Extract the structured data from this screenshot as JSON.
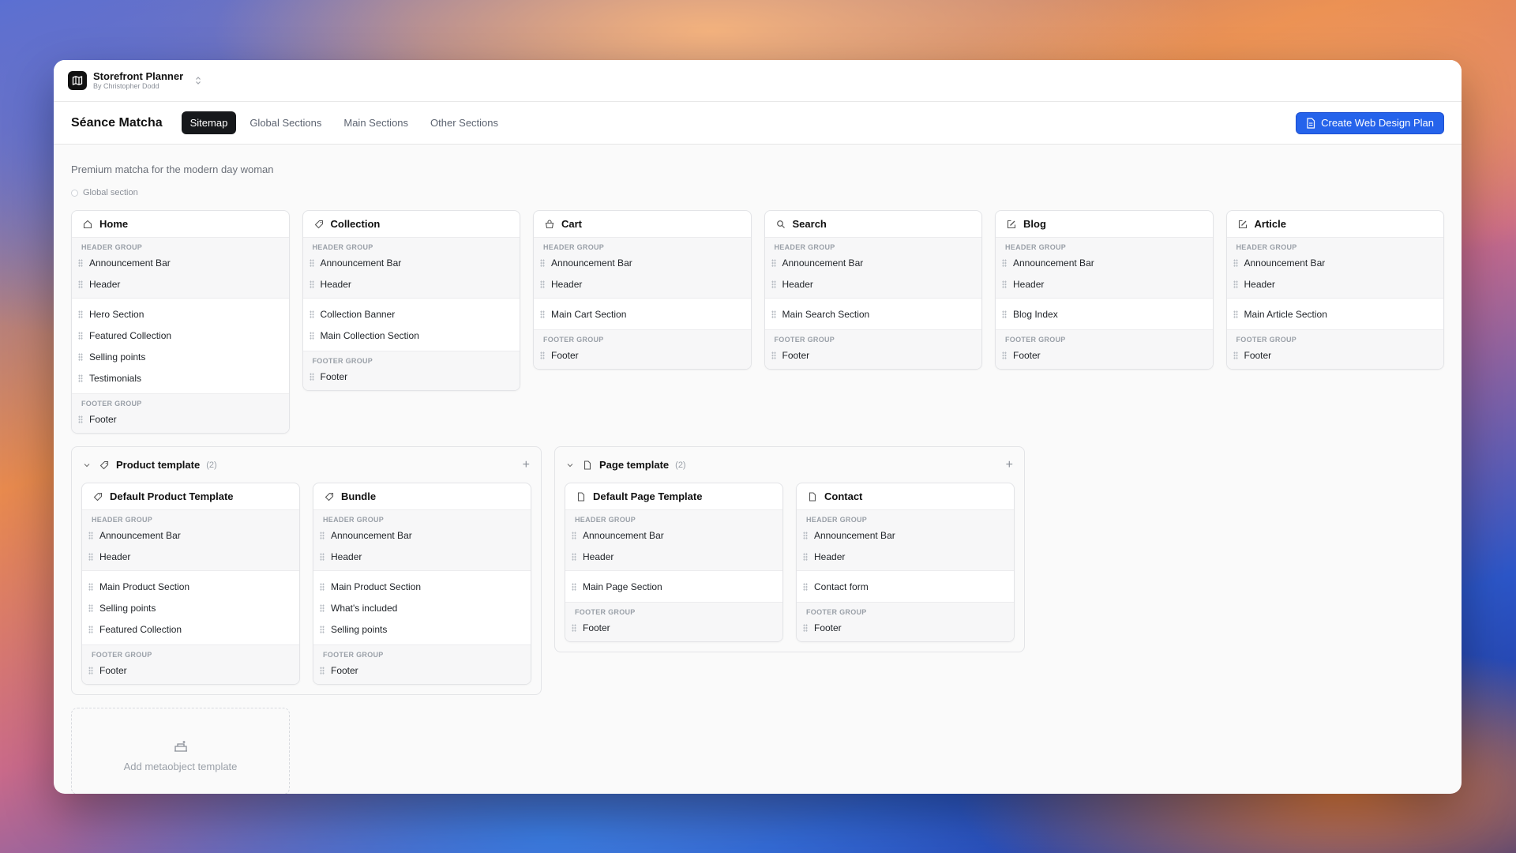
{
  "app": {
    "title": "Storefront Planner",
    "subtitle": "By Christopher Dodd"
  },
  "nav": {
    "store_name": "Séance Matcha",
    "tabs": [
      {
        "label": "Sitemap",
        "active": true
      },
      {
        "label": "Global Sections",
        "active": false
      },
      {
        "label": "Main Sections",
        "active": false
      },
      {
        "label": "Other Sections",
        "active": false
      }
    ],
    "create_button": "Create Web Design Plan"
  },
  "colors": {
    "accent": "#2563eb",
    "active_tab": "#16181b"
  },
  "tagline": "Premium matcha for the modern day woman",
  "legend": "Global section",
  "pages": [
    {
      "title": "Home",
      "icon": "home-icon",
      "header_label": "HEADER GROUP",
      "header": [
        "Announcement Bar",
        "Header"
      ],
      "main": [
        "Hero Section",
        "Featured Collection",
        "Selling points",
        "Testimonials"
      ],
      "footer_label": "FOOTER GROUP",
      "footer": [
        "Footer"
      ]
    },
    {
      "title": "Collection",
      "icon": "tag-icon",
      "header_label": "HEADER GROUP",
      "header": [
        "Announcement Bar",
        "Header"
      ],
      "main": [
        "Collection Banner",
        "Main Collection Section"
      ],
      "footer_label": "FOOTER GROUP",
      "footer": [
        "Footer"
      ]
    },
    {
      "title": "Cart",
      "icon": "cart-icon",
      "header_label": "HEADER GROUP",
      "header": [
        "Announcement Bar",
        "Header"
      ],
      "main": [
        "Main Cart Section"
      ],
      "footer_label": "FOOTER GROUP",
      "footer": [
        "Footer"
      ]
    },
    {
      "title": "Search",
      "icon": "search-icon",
      "header_label": "HEADER GROUP",
      "header": [
        "Announcement Bar",
        "Header"
      ],
      "main": [
        "Main Search Section"
      ],
      "footer_label": "FOOTER GROUP",
      "footer": [
        "Footer"
      ]
    },
    {
      "title": "Blog",
      "icon": "edit-icon",
      "header_label": "HEADER GROUP",
      "header": [
        "Announcement Bar",
        "Header"
      ],
      "main": [
        "Blog Index"
      ],
      "footer_label": "FOOTER GROUP",
      "footer": [
        "Footer"
      ]
    },
    {
      "title": "Article",
      "icon": "edit-icon",
      "header_label": "HEADER GROUP",
      "header": [
        "Announcement Bar",
        "Header"
      ],
      "main": [
        "Main Article Section"
      ],
      "footer_label": "FOOTER GROUP",
      "footer": [
        "Footer"
      ]
    }
  ],
  "template_groups": [
    {
      "title": "Product template",
      "count": "(2)",
      "icon": "tag-icon",
      "templates": [
        {
          "title": "Default Product Template",
          "icon": "tag-icon",
          "header_label": "HEADER GROUP",
          "header": [
            "Announcement Bar",
            "Header"
          ],
          "main": [
            "Main Product Section",
            "Selling points",
            "Featured Collection"
          ],
          "footer_label": "FOOTER GROUP",
          "footer": [
            "Footer"
          ]
        },
        {
          "title": "Bundle",
          "icon": "tag-icon",
          "header_label": "HEADER GROUP",
          "header": [
            "Announcement Bar",
            "Header"
          ],
          "main": [
            "Main Product Section",
            "What's included",
            "Selling points"
          ],
          "footer_label": "FOOTER GROUP",
          "footer": [
            "Footer"
          ]
        }
      ]
    },
    {
      "title": "Page template",
      "count": "(2)",
      "icon": "file-icon",
      "templates": [
        {
          "title": "Default Page Template",
          "icon": "file-icon",
          "header_label": "HEADER GROUP",
          "header": [
            "Announcement Bar",
            "Header"
          ],
          "main": [
            "Main Page Section"
          ],
          "footer_label": "FOOTER GROUP",
          "footer": [
            "Footer"
          ]
        },
        {
          "title": "Contact",
          "icon": "file-icon",
          "header_label": "HEADER GROUP",
          "header": [
            "Announcement Bar",
            "Header"
          ],
          "main": [
            "Contact form"
          ],
          "footer_label": "FOOTER GROUP",
          "footer": [
            "Footer"
          ]
        }
      ]
    }
  ],
  "add_metaobject": {
    "label": "Add metaobject template",
    "icon": "add-template-icon"
  }
}
